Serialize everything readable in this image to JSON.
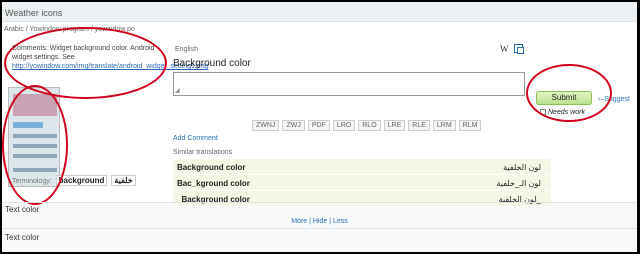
{
  "header": {
    "title": "Weather icons"
  },
  "breadcrumb": "Arabic / Yowindow program / yowindow.po",
  "comments": {
    "label": "Comments:",
    "text": "Widget background color. Android widget settings. See",
    "link": "http://yowindow.com/img/translate/android_widget_settings.png"
  },
  "term": {
    "label": "Terminology:",
    "source": "background",
    "translation": "خلفية"
  },
  "editor": {
    "language": "English",
    "source_text": "Background color",
    "submit_label": "Submit",
    "suggest_label": "Suggest",
    "needs_work_label": "Needs work",
    "marks": [
      "ZWNJ",
      "ZWJ",
      "PDF",
      "LRO",
      "RLO",
      "LRE",
      "RLE",
      "LRM",
      "RLM"
    ],
    "add_comment": "Add Comment"
  },
  "similar": {
    "label": "Similar translations",
    "rows": [
      {
        "source": "Background color",
        "translation": "لون الخلفية"
      },
      {
        "source": "Bac_kground color",
        "translation": "لون الـ_خلفية"
      },
      {
        "source": "_Background color",
        "translation": "_لون الخلفية"
      }
    ]
  },
  "sections": {
    "text_color": "Text color",
    "more_links": "More | Hide | Less",
    "text_color_2": "Text color"
  },
  "colors": {
    "annotation": "#d0021b",
    "submit": "#b9e18a",
    "link": "#2a6fb7"
  }
}
